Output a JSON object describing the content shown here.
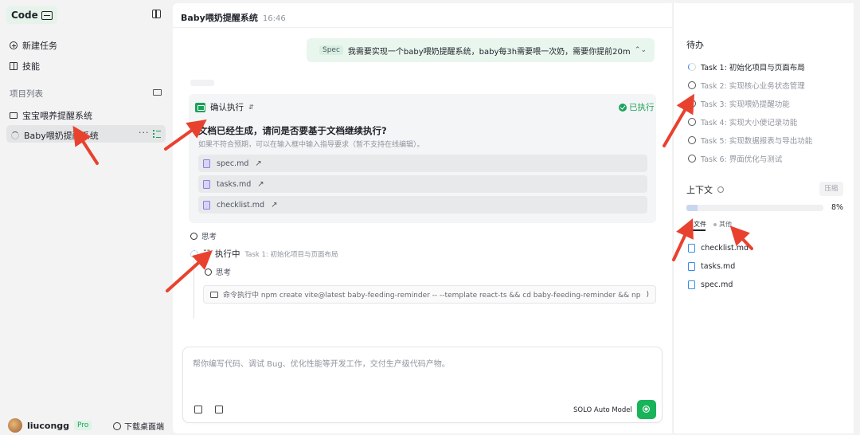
{
  "sidebar": {
    "brand": "Code",
    "nav": [
      {
        "label": "新建任务",
        "icon": "plus-circle-icon"
      },
      {
        "label": "技能",
        "icon": "book-icon"
      }
    ],
    "section_label": "项目列表",
    "projects": [
      {
        "label": "宝宝喂养提醒系统",
        "icon": "folder-icon"
      },
      {
        "label": "Baby喂奶提醒系统",
        "icon": "loading-icon",
        "active": true
      }
    ],
    "user": {
      "name": "liucongg",
      "badge": "Pro"
    },
    "download_label": "下载桌面端"
  },
  "main": {
    "title": "Baby喂奶提醒系统",
    "time": "16:46",
    "spec_tag": "Spec",
    "spec_message": "我需要实现一个baby喂奶提醒系统，baby每3h需要喂一次奶，需要你提前20min提醒",
    "confirm": {
      "label": "确认执行",
      "status": "已执行",
      "question": "文档已经生成，请问是否要基于文档继续执行?",
      "hint": "如果不符合预期，可以在输入框中输入指导要求（暂不支持在线编辑）。",
      "files": [
        "spec.md",
        "tasks.md",
        "checklist.md"
      ]
    },
    "thinking_label": "思考",
    "running": {
      "label": "执行中",
      "sub": "Task 1: 初始化项目与页面布局"
    },
    "thinking_label_2": "思考",
    "command": "命令执行中  npm create vite@latest baby-feeding-reminder -- --template react-ts && cd baby-feeding-reminder && npm install && ···",
    "input_placeholder": "帮你编写代码、调试 Bug、优化性能等开发工作，交付生产级代码产物。",
    "model_label": "SOLO Auto Model"
  },
  "right": {
    "todo_title": "待办",
    "tasks": [
      {
        "label": "Task 1: 初始化项目与页面布局",
        "active": true
      },
      {
        "label": "Task 2: 实现核心业务状态管理",
        "active": false
      },
      {
        "label": "Task 3: 实现喂奶提醒功能",
        "active": false
      },
      {
        "label": "Task 4: 实现大小便记录功能",
        "active": false
      },
      {
        "label": "Task 5: 实现数据报表与导出功能",
        "active": false
      },
      {
        "label": "Task 6: 界面优化与测试",
        "active": false
      }
    ],
    "context_title": "上下文",
    "compress_label": "压缩",
    "context_percent": "8%",
    "context_fraction": 0.08,
    "tabs": [
      "文件",
      "其他"
    ],
    "files": [
      "checklist.md",
      "tasks.md",
      "spec.md"
    ]
  },
  "colors": {
    "accent": "#1aa35a",
    "annotation": "#e8422f"
  }
}
